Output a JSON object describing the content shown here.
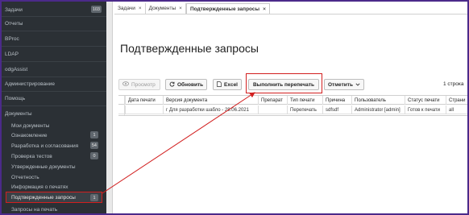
{
  "sidebar": {
    "items": [
      {
        "label": "Задачи",
        "badge": "103"
      },
      {
        "label": "Отчеты",
        "badge": ""
      },
      {
        "label": "BProc",
        "badge": ""
      },
      {
        "label": "LDAP",
        "badge": ""
      },
      {
        "label": "odgAssist",
        "badge": ""
      },
      {
        "label": "Администрирование",
        "badge": ""
      },
      {
        "label": "Помощь",
        "badge": ""
      },
      {
        "label": "Документы",
        "badge": ""
      }
    ],
    "sub_items": [
      {
        "label": "Мои документы",
        "badge": ""
      },
      {
        "label": "Ознакомление",
        "badge": "1"
      },
      {
        "label": "Разработка и согласования",
        "badge": "54"
      },
      {
        "label": "Проверка тестов",
        "badge": "0"
      },
      {
        "label": "Утвержденные документы",
        "badge": ""
      },
      {
        "label": "Отчетность",
        "badge": ""
      },
      {
        "label": "Информация о печатях",
        "badge": ""
      },
      {
        "label": "Подтвержденные запросы",
        "badge": "1"
      },
      {
        "label": "Запросы на печать",
        "badge": ""
      }
    ]
  },
  "tabs": [
    {
      "label": "Задачи",
      "close": "×"
    },
    {
      "label": "Документы",
      "close": "×"
    },
    {
      "label": "Подтвержденные запросы",
      "close": "×"
    }
  ],
  "page_title": "Подтвержденные запросы",
  "toolbar": {
    "preview_label": "Просмотр",
    "refresh_label": "Обновить",
    "excel_label": "Excel",
    "reprint_label": "Выполнить перепечать",
    "mark_label": "Отметить",
    "row_count": "1 строка"
  },
  "table": {
    "columns": [
      "Дата печати",
      "Версия документа",
      "Препарат",
      "Тип печати",
      "Причина",
      "Пользователь",
      "Статус печати",
      "Страни"
    ],
    "rows": [
      [
        "",
        "г Для разработки шабло - 28.06.2021",
        "",
        "Перепечать",
        "sdfsdf",
        "Administrator [admin]",
        "Готов к печати",
        "all"
      ]
    ]
  },
  "colors": {
    "sidebar_bg": "#2b3035",
    "annotation_red": "#d21f1f",
    "frame": "#4b2a8a"
  }
}
